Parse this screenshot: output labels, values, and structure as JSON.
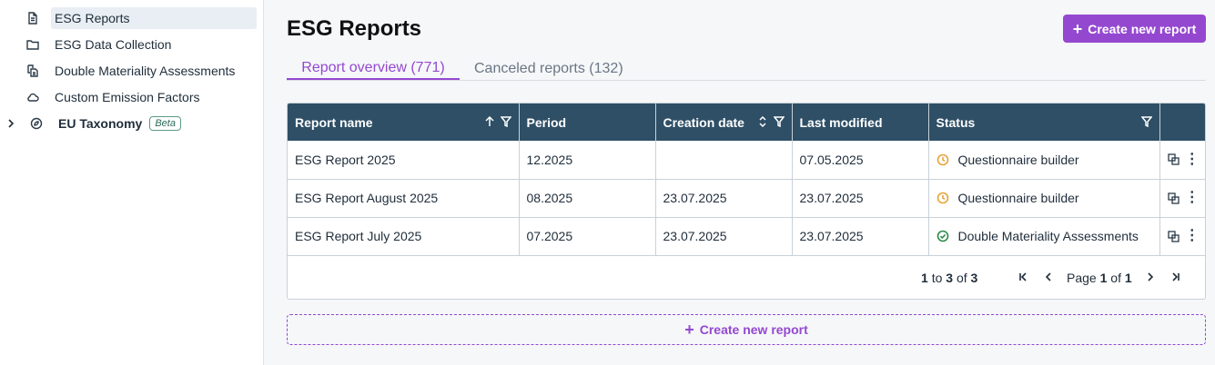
{
  "sidebar": {
    "items": [
      {
        "label": "ESG Reports",
        "icon": "document-icon"
      },
      {
        "label": "ESG Data Collection",
        "icon": "folder-icon"
      },
      {
        "label": "Double Materiality Assessments",
        "icon": "copy-document-icon"
      },
      {
        "label": "Custom Emission Factors",
        "icon": "cloud-icon"
      },
      {
        "label": "EU Taxonomy",
        "icon": "leaf-icon",
        "badge": "Beta"
      }
    ]
  },
  "header": {
    "title": "ESG Reports",
    "create_label": "Create new report"
  },
  "tabs": [
    {
      "label": "Report overview (771)"
    },
    {
      "label": "Canceled reports (132)"
    }
  ],
  "table": {
    "columns": [
      "Report name",
      "Period",
      "Creation date",
      "Last modified",
      "Status"
    ],
    "rows": [
      {
        "name": "ESG Report 2025",
        "period": "12.2025",
        "created": "",
        "modified": "07.05.2025",
        "status": "Questionnaire builder",
        "status_kind": "pending"
      },
      {
        "name": "ESG Report August 2025",
        "period": "08.2025",
        "created": "23.07.2025",
        "modified": "23.07.2025",
        "status": "Questionnaire builder",
        "status_kind": "pending"
      },
      {
        "name": "ESG Report July 2025",
        "period": "07.2025",
        "created": "23.07.2025",
        "modified": "23.07.2025",
        "status": "Double Materiality Assessments",
        "status_kind": "done"
      }
    ]
  },
  "pager": {
    "from": "1",
    "to": "3",
    "total": "3",
    "to_word": "to",
    "of_word": "of",
    "page_word": "Page",
    "page": "1",
    "pages": "1"
  },
  "footer": {
    "create_label": "Create new report"
  },
  "colors": {
    "accent": "#9448d0",
    "header_bg": "#2e4f66",
    "pending": "#e8a33a",
    "done": "#2e8b4a"
  }
}
